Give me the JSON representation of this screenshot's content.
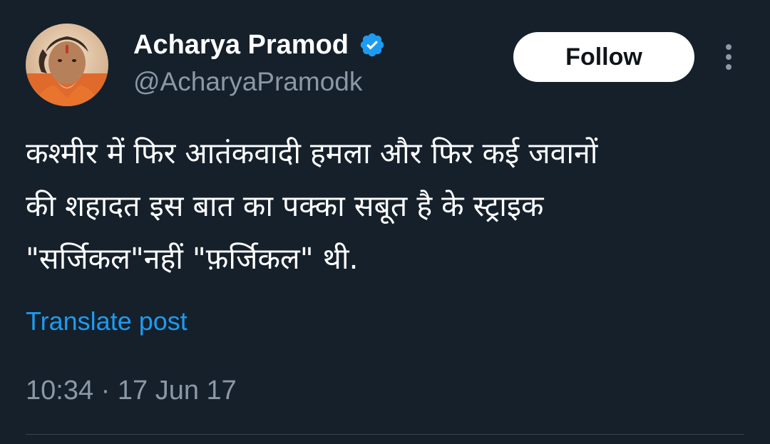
{
  "author": {
    "display_name": "Acharya Pramod",
    "handle": "@AcharyaPramodk",
    "verified": true,
    "verified_icon": "verified-badge-icon",
    "avatar_icon": "profile-photo"
  },
  "actions": {
    "follow_label": "Follow",
    "more_icon": "more-options-icon"
  },
  "tweet": {
    "text_lines": [
      "कश्मीर में फिर आतंकवादी हमला और फिर कई जवानों",
      "की शहादत इस बात का पक्का सबूत है के स्ट्राइक",
      "\"सर्जिकल\"नहीं \"फ़र्जिकल\" थी."
    ],
    "translate_label": "Translate post",
    "timestamp": "10:34 · 17 Jun 17"
  },
  "colors": {
    "background": "#15202b",
    "primary_text": "#ffffff",
    "secondary_text": "#8b98a5",
    "accent": "#1d9bf0",
    "divider": "#38444d"
  }
}
